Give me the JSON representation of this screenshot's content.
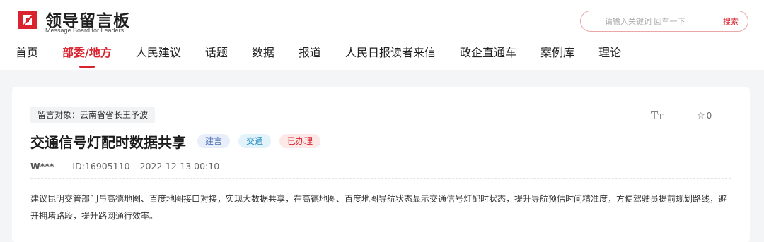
{
  "header": {
    "logo_title": "领导留言板",
    "logo_subtitle": "Message Board for Leaders",
    "search": {
      "placeholder": "请输入关键词 回车一下",
      "button_label": "搜索"
    }
  },
  "nav": {
    "items": [
      {
        "label": "首页"
      },
      {
        "label": "部委/地方"
      },
      {
        "label": "人民建议"
      },
      {
        "label": "话题"
      },
      {
        "label": "数据"
      },
      {
        "label": "报道"
      },
      {
        "label": "人民日报读者来信"
      },
      {
        "label": "政企直通车"
      },
      {
        "label": "案例库"
      },
      {
        "label": "理论"
      }
    ],
    "active_index": 1
  },
  "post": {
    "target": "留言对象：云南省省长王予波",
    "title": "交通信号灯配时数据共享",
    "type_badge": "建言",
    "field_badge": "交通",
    "status_badge": "已办理",
    "author": "W***",
    "id": "ID:16905110",
    "datetime": "2022-12-13 00:10",
    "font_toggle_big": "T",
    "font_toggle_small": "T",
    "star_count": "0",
    "content": "建议昆明交管部门与高德地图、百度地图接口对接，实现大数据共享，在高德地图、百度地图导航状态显示交通信号灯配时状态，提升导航预估时间精准度，方便驾驶员提前规划路线，避开拥堵路段，提升路网通行效率。"
  },
  "colors": {
    "brand_red": "#d9232e",
    "page_bg": "#f4f5f7"
  },
  "icons": {
    "logo": "logo-mark-icon",
    "font_size": "font-size-icon",
    "star": "star-icon"
  }
}
